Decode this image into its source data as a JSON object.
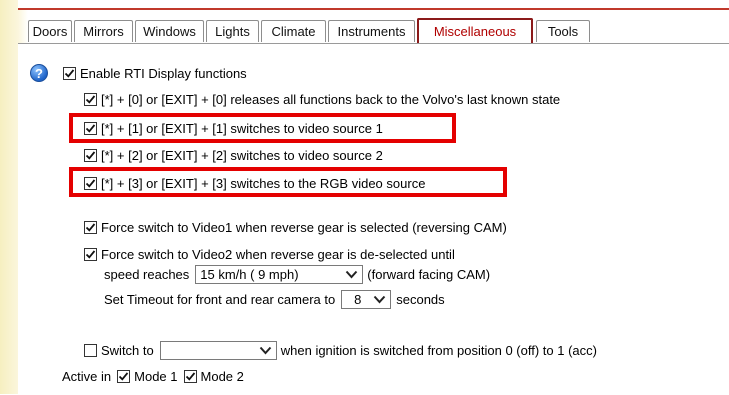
{
  "tabs": [
    {
      "label": "Doors"
    },
    {
      "label": "Mirrors"
    },
    {
      "label": "Windows"
    },
    {
      "label": "Lights"
    },
    {
      "label": "Climate"
    },
    {
      "label": "Instruments"
    },
    {
      "label": "Miscellaneous",
      "active": true
    },
    {
      "label": "Tools"
    }
  ],
  "help_symbol": "?",
  "rti": {
    "enable_label": "Enable RTI Display functions",
    "enable_checked": true,
    "options": [
      {
        "label": "[*] + [0] or [EXIT] + [0] releases all functions back to the Volvo's last known state",
        "checked": true
      },
      {
        "label": "[*] + [1] or [EXIT] + [1] switches to video source 1",
        "checked": true,
        "highlighted": true
      },
      {
        "label": "[*] + [2] or [EXIT] + [2] switches to video source 2",
        "checked": true
      },
      {
        "label": "[*] + [3] or [EXIT] + [3] switches to the RGB video source",
        "checked": true,
        "highlighted": true
      }
    ]
  },
  "reverse": {
    "force_video1_label": "Force switch to Video1 when reverse gear is selected (reversing CAM)",
    "force_video1_checked": true,
    "force_video2_label": "Force switch to Video2 when reverse gear is de-selected until",
    "force_video2_checked": true,
    "speed_prefix": "speed reaches",
    "speed_value": "15 km/h ( 9 mph)",
    "speed_suffix": "(forward facing CAM)",
    "timeout_prefix": "Set Timeout for front and rear camera to",
    "timeout_value": "8",
    "timeout_suffix": "seconds"
  },
  "ignition": {
    "switch_label": "Switch to",
    "switch_checked": false,
    "switch_value": "",
    "suffix": "when ignition is switched from position 0 (off) to 1 (acc)"
  },
  "active_in": {
    "label": "Active in",
    "mode1_label": "Mode 1",
    "mode1_checked": true,
    "mode2_label": "Mode 2",
    "mode2_checked": true
  },
  "colors": {
    "highlight": "#e40000",
    "active_tab_text": "#b00000",
    "active_tab_border": "#8b1a1a",
    "help_icon": "#1f64c9"
  },
  "icons": {
    "check": "check-icon",
    "help": "help-icon",
    "dropdown": "chevron-down-icon"
  }
}
